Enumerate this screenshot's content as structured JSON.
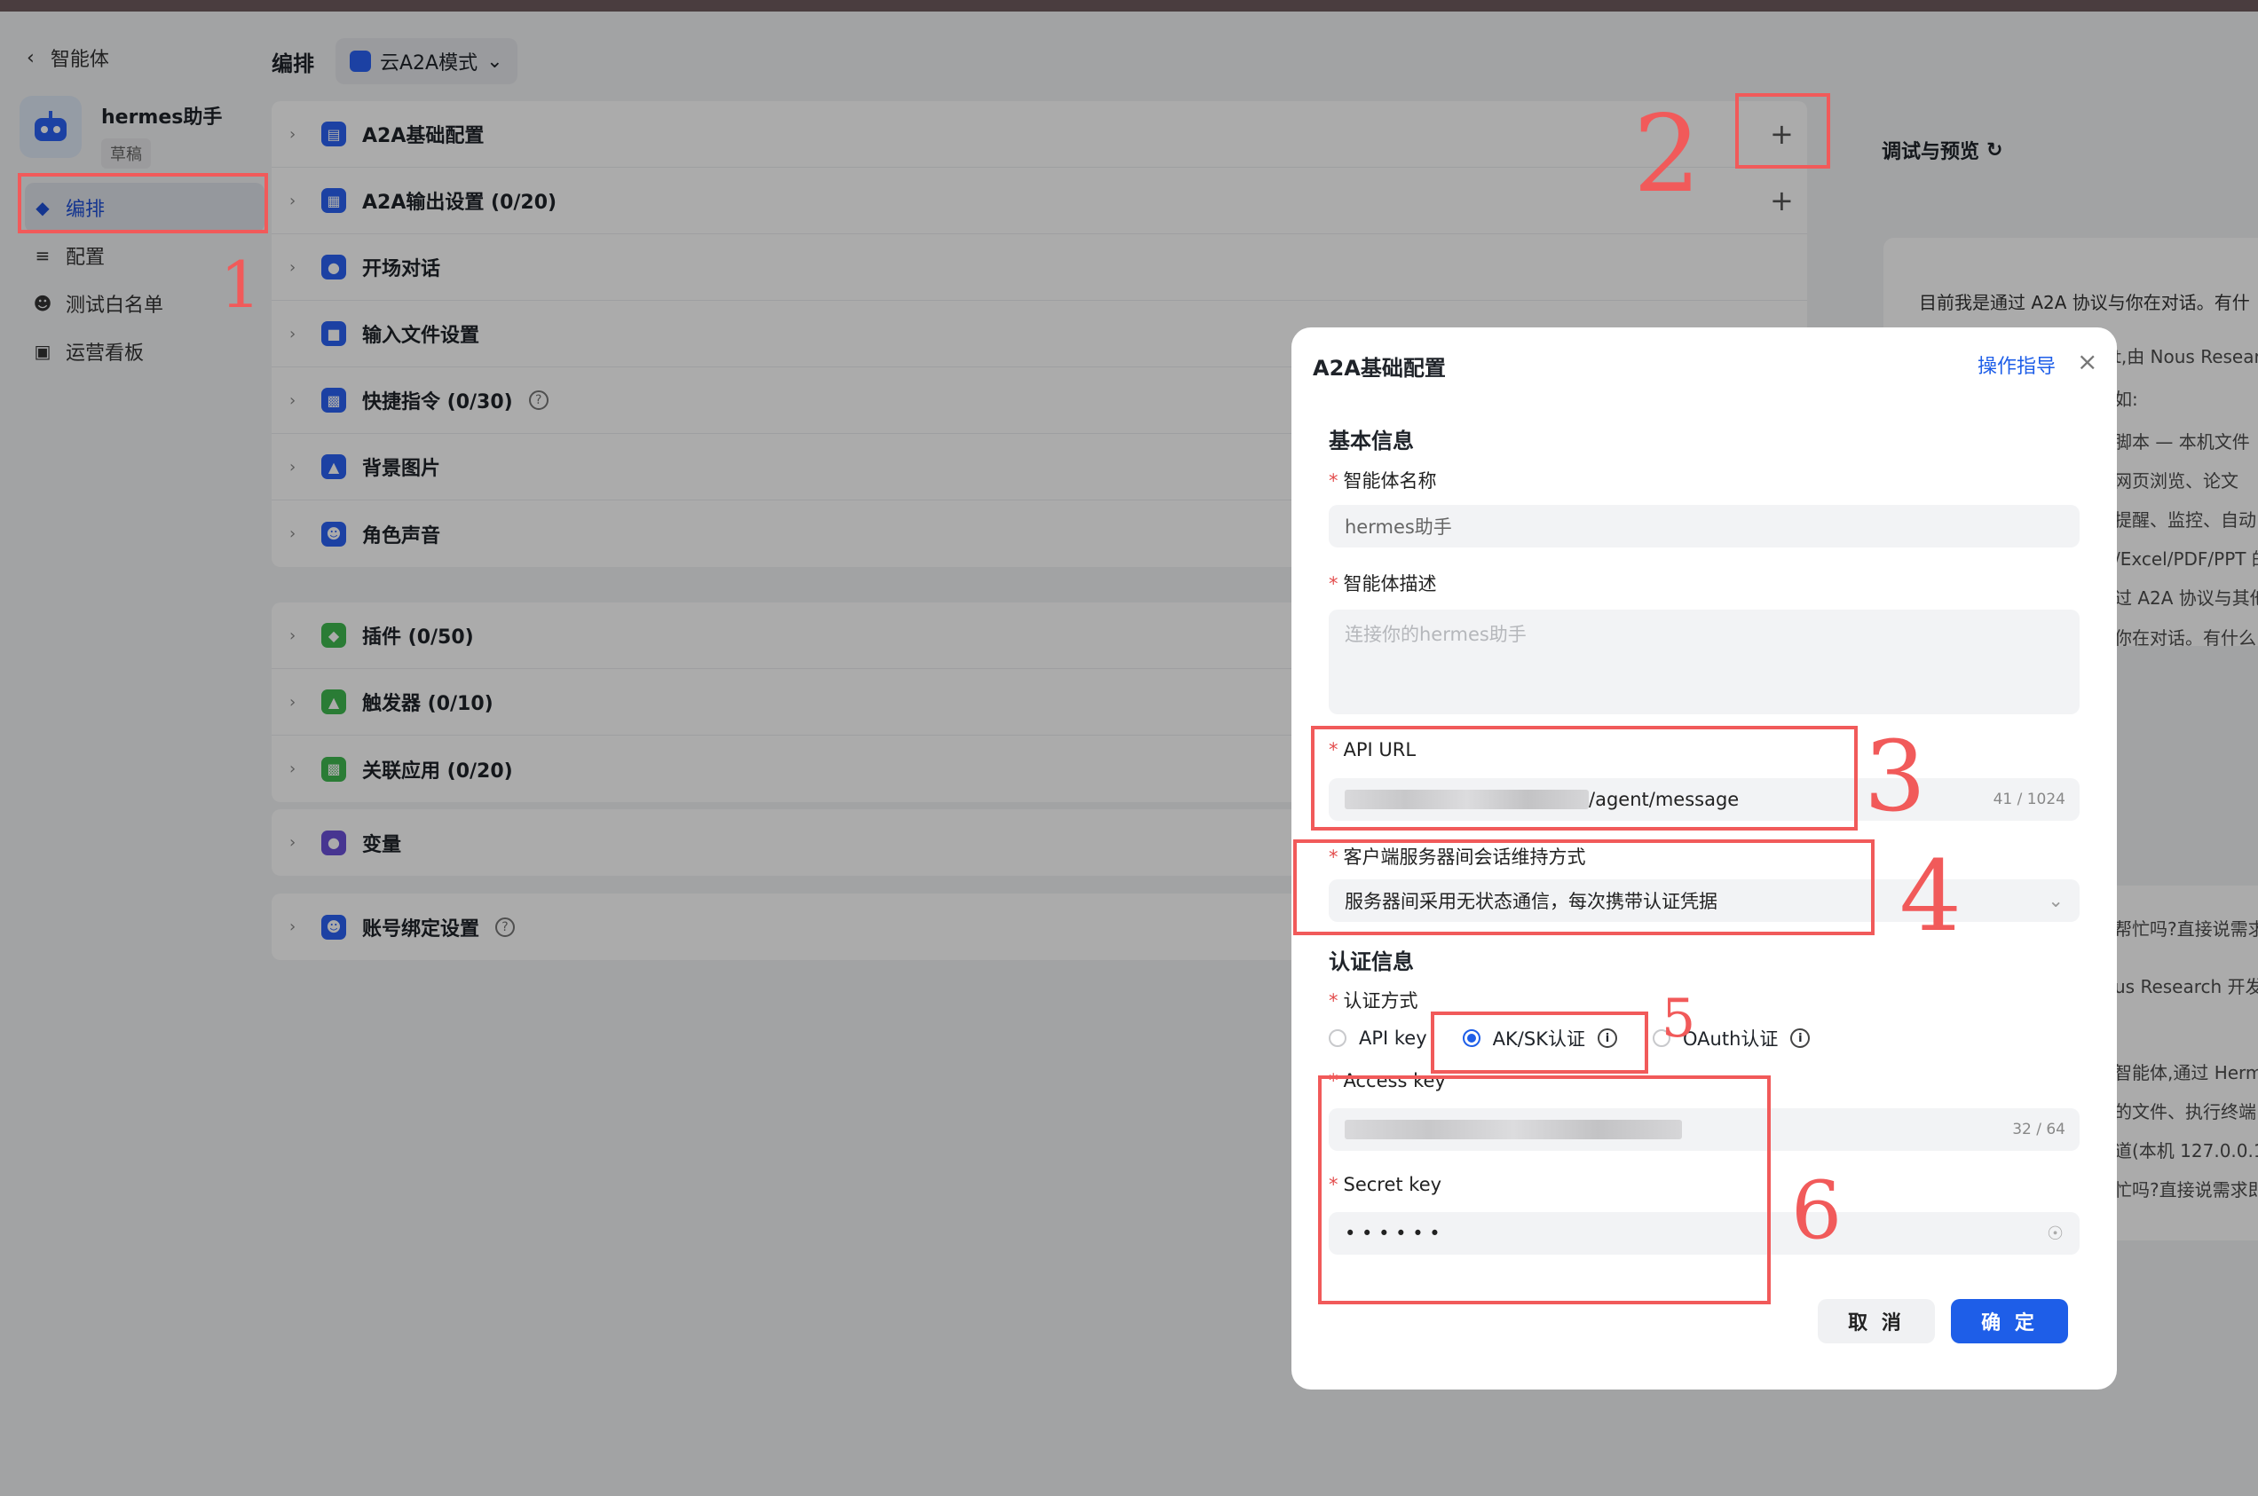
{
  "sidebar": {
    "back_label": "智能体",
    "agent_name": "hermes助手",
    "agent_status": "草稿",
    "nav": [
      {
        "label": "编排",
        "active": true
      },
      {
        "label": "配置",
        "active": false
      },
      {
        "label": "测试白名单",
        "active": false
      },
      {
        "label": "运营看板",
        "active": false
      }
    ]
  },
  "header": {
    "title": "编排",
    "mode": "云A2A模式"
  },
  "sections": {
    "group1": [
      {
        "label": "A2A基础配置",
        "icon_color": "#2a62f4"
      },
      {
        "label": "A2A输出设置 (0/20)",
        "icon_color": "#2a62f4"
      },
      {
        "label": "开场对话",
        "icon_color": "#2a62f4"
      },
      {
        "label": "输入文件设置",
        "icon_color": "#2a62f4"
      },
      {
        "label": "快捷指令 (0/30)",
        "icon_color": "#2a62f4"
      },
      {
        "label": "背景图片",
        "icon_color": "#2a62f4"
      },
      {
        "label": "角色声音",
        "icon_color": "#2a62f4"
      }
    ],
    "group2": [
      {
        "label": "插件 (0/50)",
        "icon_color": "#3fb950"
      },
      {
        "label": "触发器 (0/10)",
        "icon_color": "#3fb950"
      },
      {
        "label": "关联应用 (0/20)",
        "icon_color": "#3fb950"
      }
    ],
    "group3": [
      {
        "label": "变量",
        "icon_color": "#6b4fd8"
      }
    ],
    "group4": [
      {
        "label": "账号绑定设置",
        "icon_color": "#2a62f4"
      }
    ]
  },
  "preview": {
    "title": "调试与预览",
    "lines": [
      "目前我是通过 A2A 协议与你在对话。有什",
      "t,由 Nous Researc",
      "如:",
      "脚本 — 本机文件",
      "网页浏览、论文",
      "提醒、监控、自动",
      "/Excel/PDF/PPT 的",
      "过 A2A 协议与其他",
      "你在对话。有什么",
      "帮忙吗?直接说需求",
      "us Research 开发",
      "智能体,通过 Herme",
      "的文件、执行终端",
      "道(本机 127.0.0.1",
      "忙吗?直接说需求即"
    ]
  },
  "modal": {
    "title": "A2A基础配置",
    "guide": "操作指导",
    "basic_section": "基本信息",
    "name_label": "智能体名称",
    "name_value": "hermes助手",
    "desc_label": "智能体描述",
    "desc_placeholder": "连接你的hermes助手",
    "url_label": "API URL",
    "url_suffix": "/agent/message",
    "url_counter": "41 / 1024",
    "session_label": "客户端服务器间会话维持方式",
    "session_value": "服务器间采用无状态通信，每次携带认证凭据",
    "auth_section": "认证信息",
    "auth_label": "认证方式",
    "auth_options": [
      "API key",
      "AK/SK认证",
      "OAuth认证"
    ],
    "auth_selected": "AK/SK认证",
    "ak_label": "Access key",
    "ak_counter": "32 / 64",
    "sk_label": "Secret key",
    "sk_value": "• • • • • •",
    "cancel": "取 消",
    "confirm": "确 定"
  },
  "annotations": [
    "1",
    "2",
    "3",
    "4",
    "5",
    "6"
  ],
  "colors": {
    "accent": "#1e5ee8",
    "annotation": "#f15a5a"
  }
}
